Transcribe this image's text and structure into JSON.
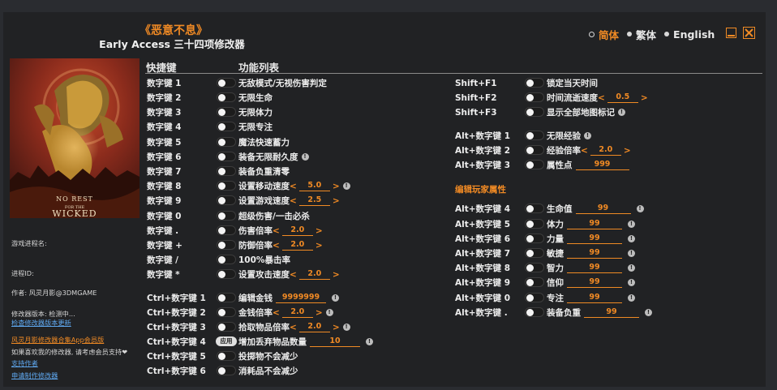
{
  "header": {
    "game_title": "《恶意不息》",
    "subtitle": "Early Access 三十四项修改器"
  },
  "languages": [
    {
      "label": "简体",
      "selected": true
    },
    {
      "label": "繁体",
      "selected": false
    },
    {
      "label": "English",
      "selected": false
    }
  ],
  "window_buttons": {
    "minimize": "minimize-icon",
    "close": "close-icon"
  },
  "cover": {
    "logo_text": "NO REST FOR THE WICKED"
  },
  "sidebar": {
    "process_name_label": "游戏进程名:",
    "process_id_label": "进程ID:",
    "author": "作者: 风灵月影@3DMGAME",
    "version": "修改器版本: 检测中...",
    "check_update": "检查修改器版本更新",
    "app_promo": "风灵月影修改器合集App会员版",
    "support_text": "如果喜欢我的修改器, 请考虑会员支持❤",
    "support_author": "支持作者",
    "request_trainer": "申请制作修改器"
  },
  "columns": {
    "hotkey": "快捷键",
    "function_list": "功能列表"
  },
  "left_features": [
    {
      "key": "数字键 1",
      "name": "无敌模式/无视伤害判定"
    },
    {
      "key": "数字键 2",
      "name": "无限生命"
    },
    {
      "key": "数字键 3",
      "name": "无限体力"
    },
    {
      "key": "数字键 4",
      "name": "无限专注"
    },
    {
      "key": "数字键 5",
      "name": "魔法快速蓄力"
    },
    {
      "key": "数字键 6",
      "name": "装备无限耐久度",
      "info": true
    },
    {
      "key": "数字键 7",
      "name": "装备负重清零"
    },
    {
      "key": "数字键 8",
      "name": "设置移动速度",
      "slider": "5.0",
      "info": true
    },
    {
      "key": "数字键 9",
      "name": "设置游戏速度",
      "slider": "2.5"
    },
    {
      "key": "数字键 0",
      "name": "超级伤害/一击必杀"
    },
    {
      "key": "数字键 .",
      "name": "伤害倍率",
      "slider": "2.0"
    },
    {
      "key": "数字键 +",
      "name": "防御倍率",
      "slider": "2.0"
    },
    {
      "key": "数字键 /",
      "name": "100%暴击率"
    },
    {
      "key": "数字键 *",
      "name": "设置攻击速度",
      "slider": "2.0"
    },
    {
      "key": "Ctrl+数字键 1",
      "name": "编辑金钱",
      "value": "9999999",
      "info": true
    },
    {
      "key": "Ctrl+数字键 2",
      "name": "金钱倍率",
      "slider": "2.0",
      "info": true
    },
    {
      "key": "Ctrl+数字键 3",
      "name": "拾取物品倍率",
      "slider": "2.0",
      "info": true
    },
    {
      "key": "Ctrl+数字键 4",
      "name": "增加丢弃物品数量",
      "value": "10",
      "info": true,
      "apply": "应用"
    },
    {
      "key": "Ctrl+数字键 5",
      "name": "投掷物不会减少"
    },
    {
      "key": "Ctrl+数字键 6",
      "name": "消耗品不会减少"
    }
  ],
  "right_features": [
    {
      "key": "Shift+F1",
      "name": "锁定当天时间"
    },
    {
      "key": "Shift+F2",
      "name": "时间流逝速度",
      "slider": "0.5"
    },
    {
      "key": "Shift+F3",
      "name": "显示全部地图标记",
      "info": true
    },
    {
      "key": "Alt+数字键 1",
      "name": "无限经验",
      "info": true
    },
    {
      "key": "Alt+数字键 2",
      "name": "经验倍率",
      "slider": "2.0"
    },
    {
      "key": "Alt+数字键 3",
      "name": "属性点",
      "value": "999"
    }
  ],
  "attr_section": "编辑玩家属性",
  "attr_features": [
    {
      "key": "Alt+数字键 4",
      "name": "生命值",
      "value": "99",
      "info": true
    },
    {
      "key": "Alt+数字键 5",
      "name": "体力",
      "value": "99",
      "info": true
    },
    {
      "key": "Alt+数字键 6",
      "name": "力量",
      "value": "99",
      "info": true
    },
    {
      "key": "Alt+数字键 7",
      "name": "敏捷",
      "value": "99",
      "info": true
    },
    {
      "key": "Alt+数字键 8",
      "name": "智力",
      "value": "99",
      "info": true
    },
    {
      "key": "Alt+数字键 9",
      "name": "信仰",
      "value": "99",
      "info": true
    },
    {
      "key": "Alt+数字键 0",
      "name": "专注",
      "value": "99",
      "info": true
    },
    {
      "key": "Alt+数字键 .",
      "name": "装备负重",
      "value": "99",
      "info": true
    }
  ],
  "colors": {
    "accent": "#f08a24",
    "background": "#212224",
    "text": "#ececec",
    "link": "#5fa8f0"
  }
}
